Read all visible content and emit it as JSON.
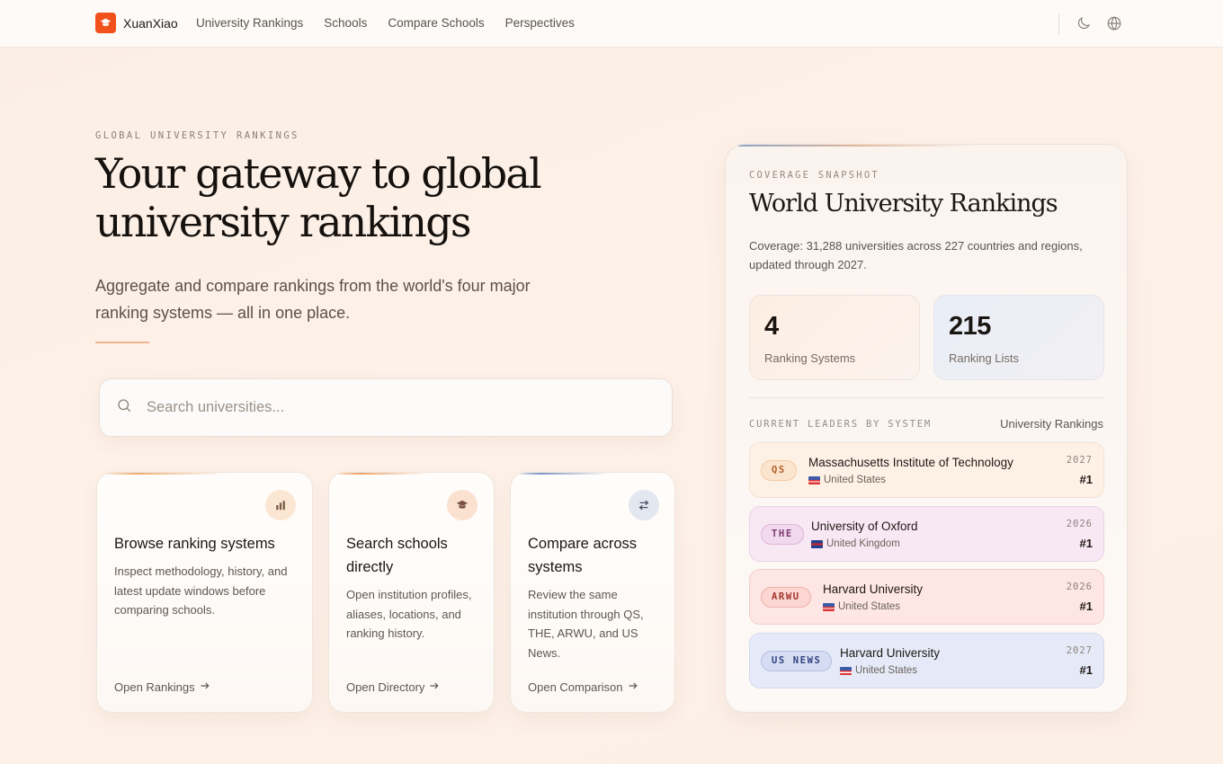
{
  "nav": {
    "brand": "XuanXiao",
    "links": [
      "University Rankings",
      "Schools",
      "Compare Schools",
      "Perspectives"
    ],
    "icons": [
      "moon-icon",
      "globe-icon"
    ]
  },
  "hero": {
    "eyebrow": "GLOBAL UNIVERSITY RANKINGS",
    "title": "Your gateway to global university rankings",
    "subtitle": "Aggregate and compare rankings from the world's four major ranking systems — all in one place."
  },
  "search": {
    "placeholder": "Search universities..."
  },
  "features": [
    {
      "title": "Browse ranking systems",
      "desc": "Inspect methodology, history, and latest update windows before comparing schools.",
      "link": "Open Rankings",
      "icon": "bar-chart-icon"
    },
    {
      "title": "Search schools directly",
      "desc": "Open institution profiles, aliases, locations, and ranking history.",
      "link": "Open Directory",
      "icon": "graduation-cap-icon"
    },
    {
      "title": "Compare across systems",
      "desc": "Review the same institution through QS, THE, ARWU, and US News.",
      "link": "Open Comparison",
      "icon": "swap-arrows-icon"
    }
  ],
  "panel": {
    "eyebrow": "COVERAGE SNAPSHOT",
    "title": "World University Rankings",
    "coverage": "Coverage: 31,288 universities across 227 countries and regions, updated through 2027.",
    "stats": [
      {
        "value": "4",
        "label": "Ranking Systems"
      },
      {
        "value": "215",
        "label": "Ranking Lists"
      }
    ],
    "leaders_label": "CURRENT LEADERS BY SYSTEM",
    "leaders_link": "University Rankings",
    "leaders": [
      {
        "system": "QS",
        "university": "Massachusetts Institute of Technology",
        "country": "United States",
        "year": "2027",
        "rank": "#1"
      },
      {
        "system": "THE",
        "university": "University of Oxford",
        "country": "United Kingdom",
        "year": "2026",
        "rank": "#1"
      },
      {
        "system": "ARWU",
        "university": "Harvard University",
        "country": "United States",
        "year": "2026",
        "rank": "#1"
      },
      {
        "system": "US NEWS",
        "university": "Harvard University",
        "country": "United States",
        "year": "2027",
        "rank": "#1"
      }
    ]
  },
  "colors": {
    "accent": "#f1521c",
    "qs": "#fdf1e6",
    "the": "#f7e8f4",
    "arwu": "#fde6e4",
    "usnews": "#e6eaf8"
  }
}
